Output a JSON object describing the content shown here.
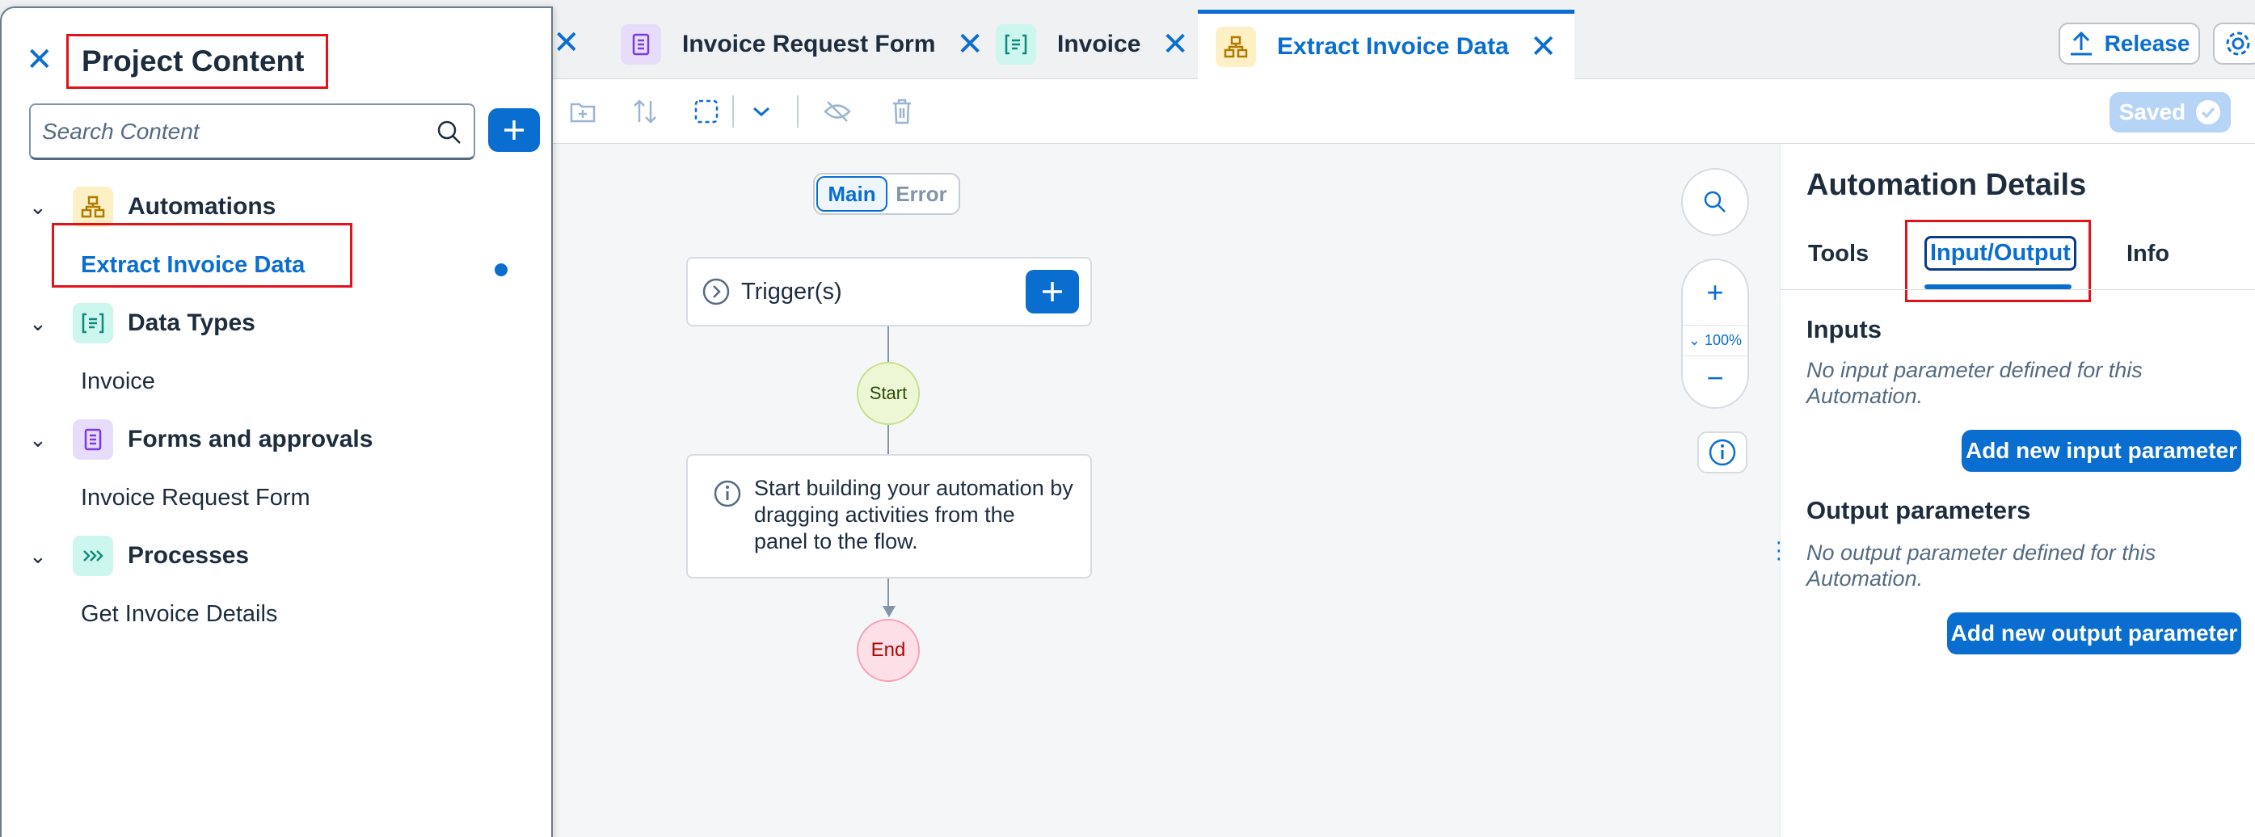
{
  "tabs": [
    {
      "label": "Invoice Request Form",
      "icon": "form-icon",
      "color": "#e8dcfb"
    },
    {
      "label": "Invoice",
      "icon": "data-type-icon",
      "color": "#cdf6ee"
    },
    {
      "label": "Extract Invoice Data",
      "icon": "automation-icon",
      "color": "#fdf0c4",
      "active": true
    }
  ],
  "header": {
    "release_label": "Release",
    "saved_label": "Saved"
  },
  "left_panel": {
    "title": "Project Content",
    "search_placeholder": "Search Content",
    "groups": [
      {
        "label": "Automations",
        "items": [
          "Extract Invoice Data"
        ]
      },
      {
        "label": "Data Types",
        "items": [
          "Invoice"
        ]
      },
      {
        "label": "Forms and approvals",
        "items": [
          "Invoice Request Form"
        ]
      },
      {
        "label": "Processes",
        "items": [
          "Get Invoice Details"
        ]
      }
    ]
  },
  "canvas": {
    "segments": [
      "Main",
      "Error"
    ],
    "trigger_label": "Trigger(s)",
    "start_label": "Start",
    "info_text": "Start building your automation by dragging activities from the panel to the flow.",
    "end_label": "End",
    "zoom_level": "100%"
  },
  "right_panel": {
    "title": "Automation Details",
    "tabs": [
      "Tools",
      "Input/Output",
      "Info"
    ],
    "active_tab": "Input/Output",
    "inputs_title": "Inputs",
    "inputs_empty": "No input parameter defined for this Automation.",
    "add_input_label": "Add new input parameter",
    "outputs_title": "Output parameters",
    "outputs_empty": "No output parameter defined for this Automation.",
    "add_output_label": "Add new output parameter"
  },
  "colors": {
    "accent": "#0a6ed1",
    "highlight": "#e3121a"
  }
}
